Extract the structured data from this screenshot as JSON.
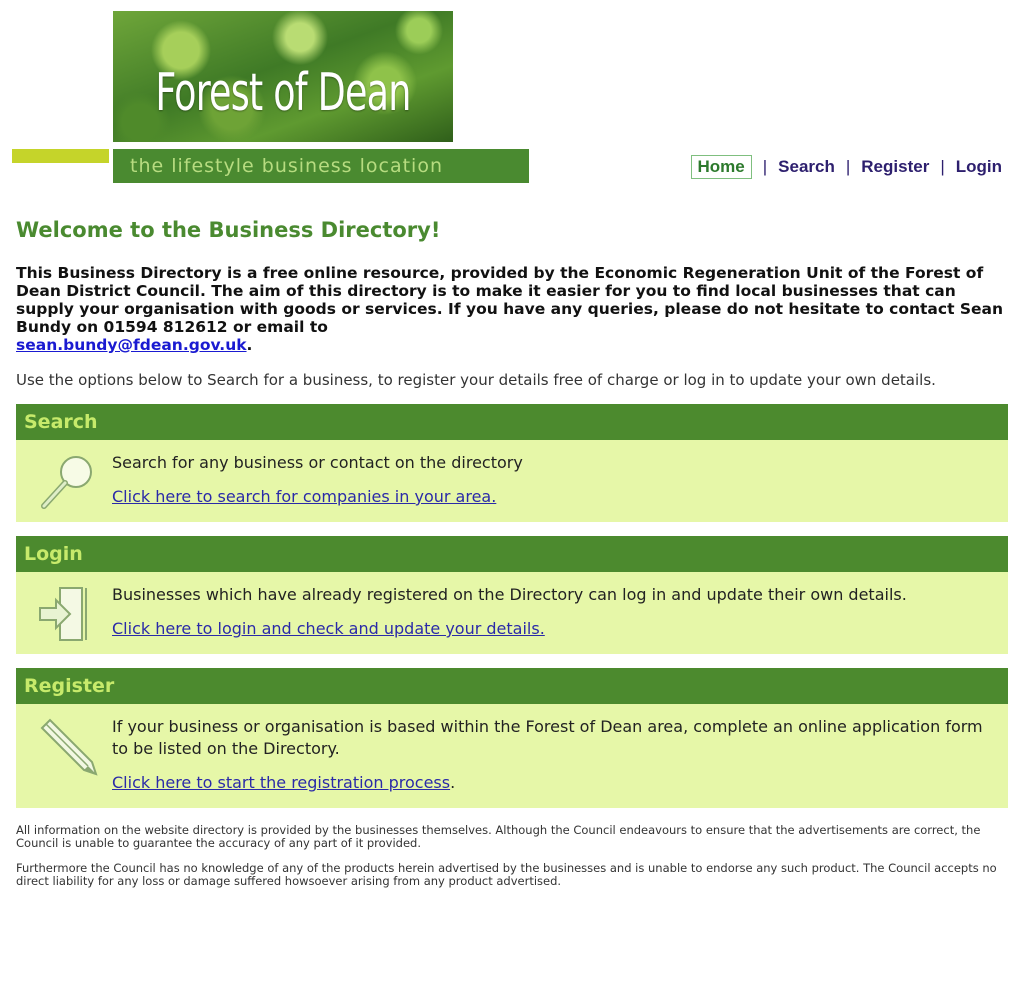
{
  "header": {
    "logo_title": "Forest of Dean",
    "tagline": "the lifestyle business location",
    "nav": {
      "home": "Home",
      "search": "Search",
      "register": "Register",
      "login": "Login",
      "separator": "|"
    }
  },
  "main": {
    "title": "Welcome to the Business Directory!",
    "intro": "This Business Directory is a free online resource, provided by the Economic Regeneration Unit of the Forest of Dean District Council. The aim of this directory is to make it easier for you to find local businesses that can supply your organisation with goods or services. If you have any queries, please do not hesitate to contact Sean Bundy on 01594 812612 or email to",
    "intro_email": "sean.bundy@fdean.gov.uk",
    "intro_end": ".",
    "options_text": "Use the options below to Search for a business, to register your details free of charge or log in to update your own details."
  },
  "sections": {
    "search": {
      "heading": "Search",
      "text": "Search for any business or contact on the directory",
      "link": "Click here to search for companies in your area."
    },
    "login": {
      "heading": "Login",
      "text": "Businesses which have already registered on the Directory can log in and update their own details.",
      "link": "Click here to login and check and update your details."
    },
    "register": {
      "heading": "Register",
      "text": "If your business or organisation is based within the Forest of Dean area, complete an online application form to be listed on the Directory.",
      "link": "Click here to start the registration process",
      "link_suffix": "."
    }
  },
  "footer": {
    "disclaimer_1": "All information on the website directory is provided by the businesses themselves. Although the Council endeavours to ensure that the advertisements are correct, the Council is unable to guarantee the accuracy of any part of it provided.",
    "disclaimer_2": "Furthermore the Council has no knowledge of any of the products herein advertised by the businesses and is unable to endorse any such product. The Council accepts no direct liability for any loss or damage suffered howsoever arising from any product advertised."
  },
  "colors": {
    "primary_green": "#4c8a2e",
    "panel_bg": "#e6f7a8",
    "accent_lime": "#c5d42a",
    "nav_text": "#2d1f6e",
    "link": "#2a2aa8"
  },
  "icons": {
    "search": "magnifier-icon",
    "login": "door-arrow-icon",
    "register": "pencil-icon"
  }
}
